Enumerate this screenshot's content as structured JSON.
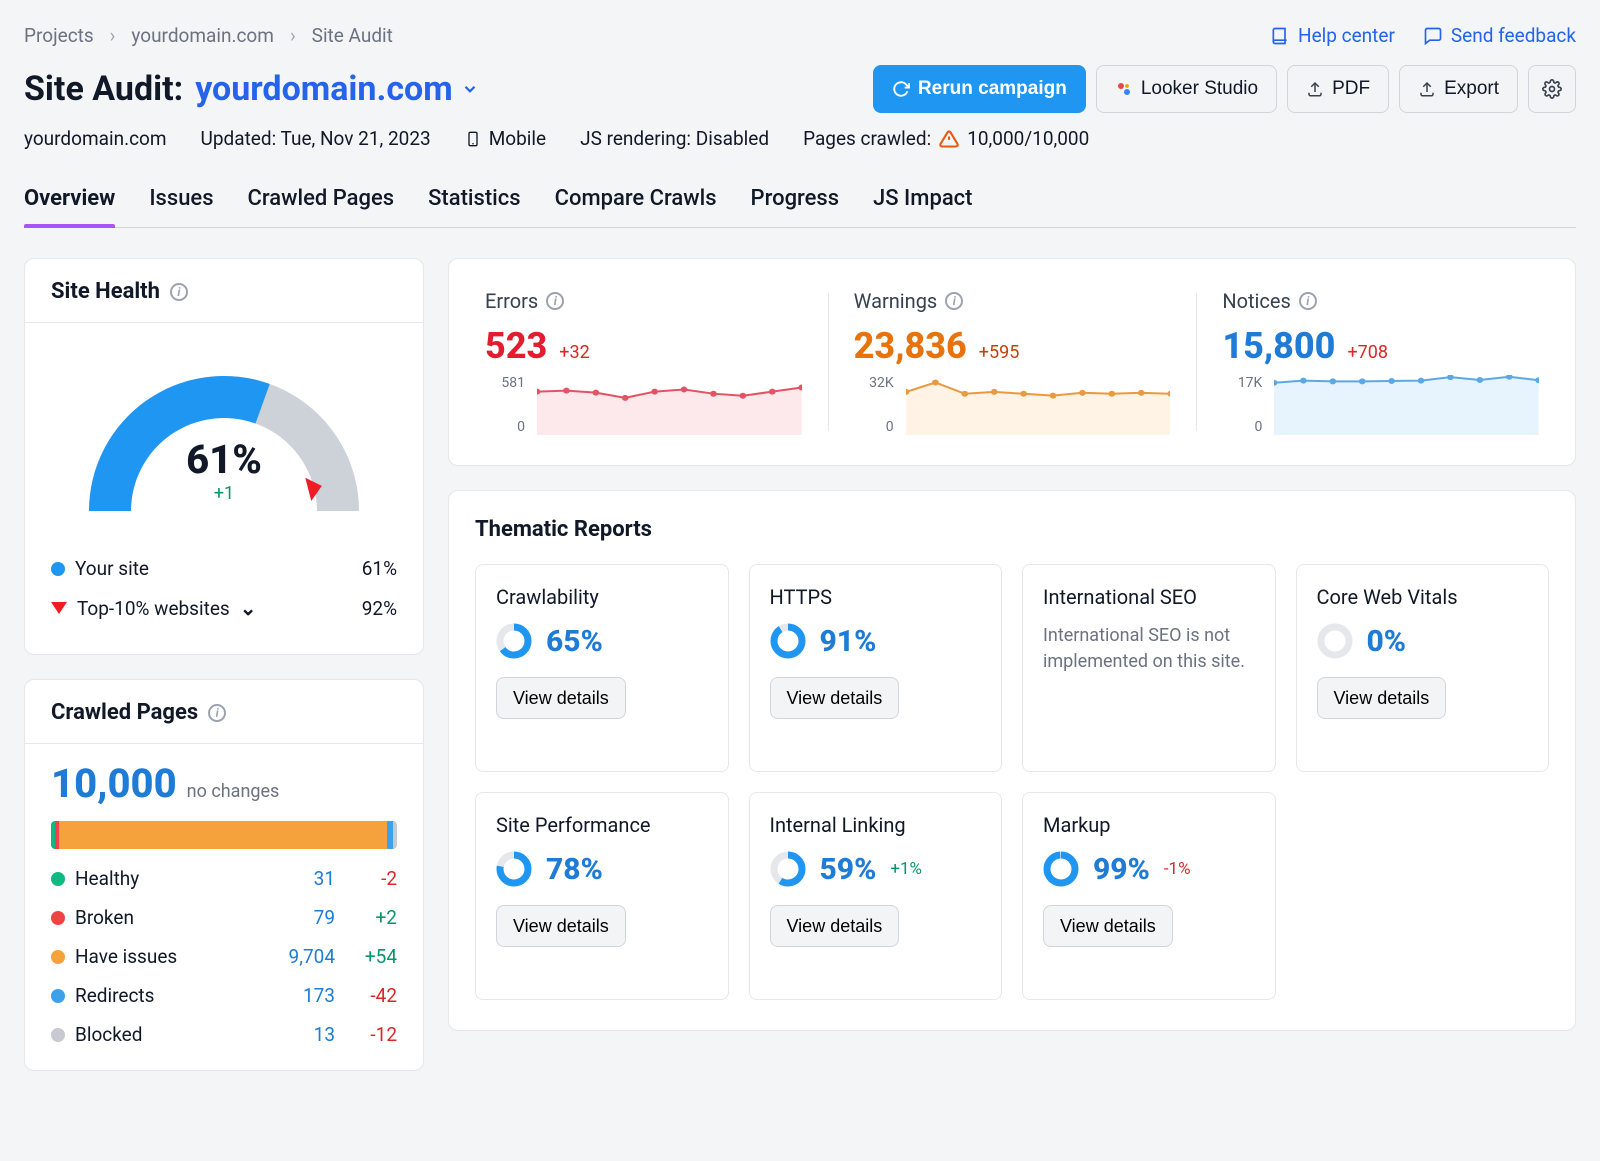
{
  "breadcrumbs": [
    "Projects",
    "yourdomain.com",
    "Site Audit"
  ],
  "help_links": {
    "help_center": "Help center",
    "send_feedback": "Send feedback"
  },
  "title": {
    "prefix": "Site Audit:",
    "domain": "yourdomain.com"
  },
  "actions": {
    "rerun": "Rerun campaign",
    "looker": "Looker Studio",
    "pdf": "PDF",
    "export": "Export"
  },
  "meta": {
    "domain": "yourdomain.com",
    "updated": "Updated: Tue, Nov 21, 2023",
    "device": "Mobile",
    "js": "JS rendering: Disabled",
    "crawled_label": "Pages crawled:",
    "crawled_value": "10,000/10,000"
  },
  "tabs": [
    "Overview",
    "Issues",
    "Crawled Pages",
    "Statistics",
    "Compare Crawls",
    "Progress",
    "JS Impact"
  ],
  "site_health": {
    "title": "Site Health",
    "percent": "61%",
    "delta": "+1",
    "legend": {
      "your_site": {
        "label": "Your site",
        "value": "61%"
      },
      "top10": {
        "label": "Top-10% websites",
        "value": "92%"
      }
    }
  },
  "crawled_pages": {
    "title": "Crawled Pages",
    "total": "10,000",
    "change_label": "no changes",
    "items": [
      {
        "label": "Healthy",
        "value": "31",
        "change": "-2",
        "color": "#10b981"
      },
      {
        "label": "Broken",
        "value": "79",
        "change": "+2",
        "color": "#ef4444"
      },
      {
        "label": "Have issues",
        "value": "9,704",
        "change": "+54",
        "color": "#f6a23c"
      },
      {
        "label": "Redirects",
        "value": "173",
        "change": "-42",
        "color": "#3da0ea"
      },
      {
        "label": "Blocked",
        "value": "13",
        "change": "-12",
        "color": "#c7cbd1"
      }
    ]
  },
  "alerts": {
    "errors": {
      "label": "Errors",
      "value": "523",
      "delta": "+32",
      "ymax": "581",
      "ymin": "0"
    },
    "warnings": {
      "label": "Warnings",
      "value": "23,836",
      "delta": "+595",
      "ymax": "32K",
      "ymin": "0"
    },
    "notices": {
      "label": "Notices",
      "value": "15,800",
      "delta": "+708",
      "ymax": "17K",
      "ymin": "0"
    }
  },
  "thematic": {
    "title": "Thematic Reports",
    "view_details": "View details",
    "reports": [
      {
        "name": "Crawlability",
        "percent": 65,
        "display": "65%",
        "delta": ""
      },
      {
        "name": "HTTPS",
        "percent": 91,
        "display": "91%",
        "delta": ""
      },
      {
        "name": "International SEO",
        "note": "International SEO is not implemented on this site."
      },
      {
        "name": "Core Web Vitals",
        "percent": 0,
        "display": "0%",
        "delta": ""
      },
      {
        "name": "Site Performance",
        "percent": 78,
        "display": "78%",
        "delta": ""
      },
      {
        "name": "Internal Linking",
        "percent": 59,
        "display": "59%",
        "delta": "+1%",
        "delta_sign": "pos"
      },
      {
        "name": "Markup",
        "percent": 99,
        "display": "99%",
        "delta": "-1%",
        "delta_sign": "neg"
      }
    ]
  },
  "chart_data": {
    "gauge": {
      "type": "gauge",
      "value": 61,
      "title": "Site Health",
      "top10_marker": 92
    },
    "crawled_stack": {
      "type": "bar",
      "stacked": true,
      "categories": [
        "Healthy",
        "Broken",
        "Have issues",
        "Redirects",
        "Blocked"
      ],
      "values": [
        31,
        79,
        9704,
        173,
        13
      ]
    },
    "errors_spark": {
      "type": "area",
      "x": [
        1,
        2,
        3,
        4,
        5,
        6,
        7,
        8,
        9,
        10
      ],
      "values": [
        420,
        430,
        410,
        360,
        420,
        440,
        400,
        380,
        420,
        460
      ],
      "ylim": [
        0,
        581
      ]
    },
    "warnings_spark": {
      "type": "area",
      "x": [
        1,
        2,
        3,
        4,
        5,
        6,
        7,
        8,
        9,
        10
      ],
      "values": [
        23000,
        28000,
        22000,
        23000,
        22000,
        21000,
        22500,
        22000,
        22500,
        22000
      ],
      "ylim": [
        0,
        32000
      ]
    },
    "notices_spark": {
      "type": "area",
      "x": [
        1,
        2,
        3,
        4,
        5,
        6,
        7,
        8,
        9,
        10
      ],
      "values": [
        14800,
        15400,
        15200,
        15200,
        15300,
        15400,
        16400,
        15600,
        16500,
        15500
      ],
      "ylim": [
        0,
        17000
      ]
    }
  }
}
